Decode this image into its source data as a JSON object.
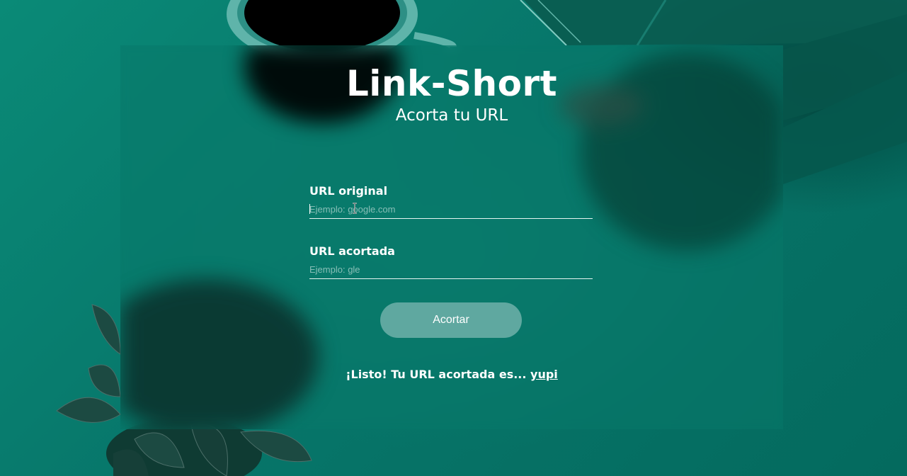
{
  "app": {
    "title": "Link-Short",
    "subtitle": "Acorta tu URL"
  },
  "form": {
    "original": {
      "label": "URL original",
      "placeholder": "Ejemplo: google.com",
      "value": ""
    },
    "shortened": {
      "label": "URL acortada",
      "placeholder": "Ejemplo: gle",
      "value": ""
    },
    "submit_label": "Acortar"
  },
  "result": {
    "message": "¡Listo! Tu URL acortada es...",
    "link_text": "yupi"
  },
  "colors": {
    "background": "#0b7a6b",
    "button": "#5fa8a0",
    "text": "#ffffff"
  }
}
